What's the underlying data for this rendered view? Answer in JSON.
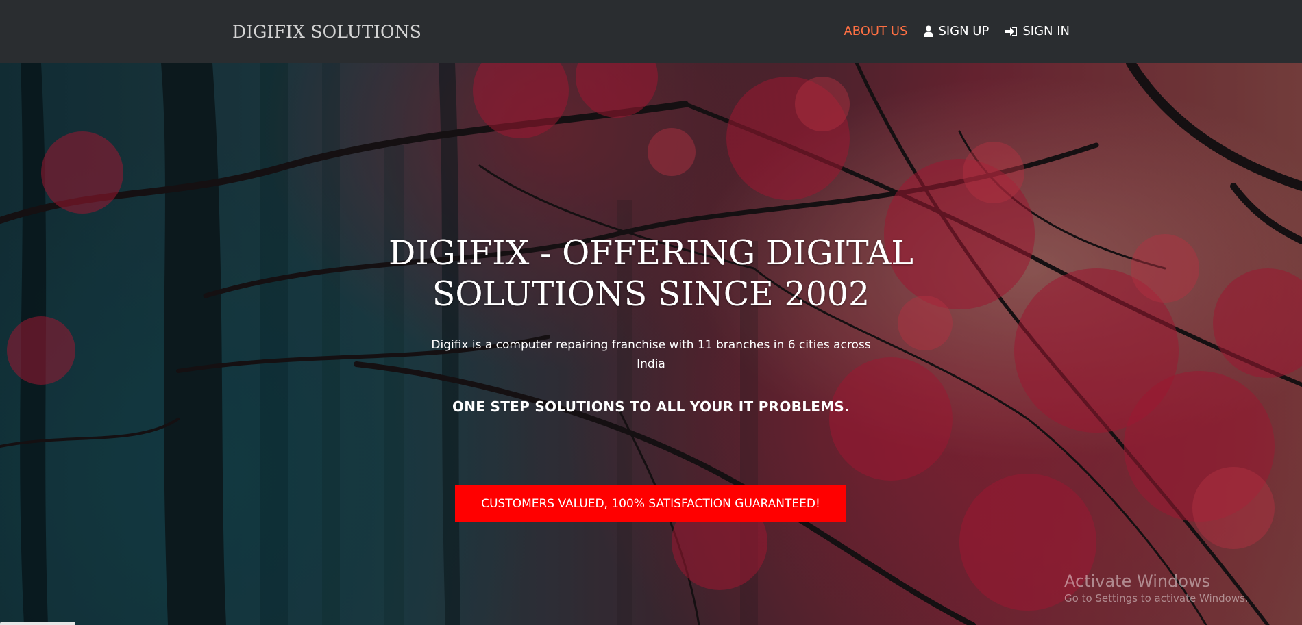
{
  "navbar": {
    "brand": "DIGIFIX SOLUTIONS",
    "links": [
      {
        "label": "ABOUT US",
        "icon": null,
        "active": true
      },
      {
        "label": "SIGN UP",
        "icon": "user-icon",
        "active": false
      },
      {
        "label": "SIGN IN",
        "icon": "sign-in-icon",
        "active": false
      }
    ]
  },
  "hero": {
    "title_line1": "DIGIFIX - OFFERING DIGITAL",
    "title_line2": "SOLUTIONS SINCE 2002",
    "description": "Digifix is a computer repairing franchise with 11 branches in 6 cities across India",
    "tagline": "ONE STEP SOLUTIONS TO ALL YOUR IT PROBLEMS.",
    "cta_label": "CUSTOMERS VALUED, 100% SATISFACTION GUARANTEED!",
    "background": "autumn-forest-image"
  },
  "overlay": {
    "activate_title": "Activate Windows",
    "activate_sub": "Go to Settings to activate Windows."
  },
  "colors": {
    "navbar_bg": "#2a2d30",
    "active_link": "#ff7043",
    "cta_bg": "#ff0000",
    "text": "#ffffff"
  }
}
